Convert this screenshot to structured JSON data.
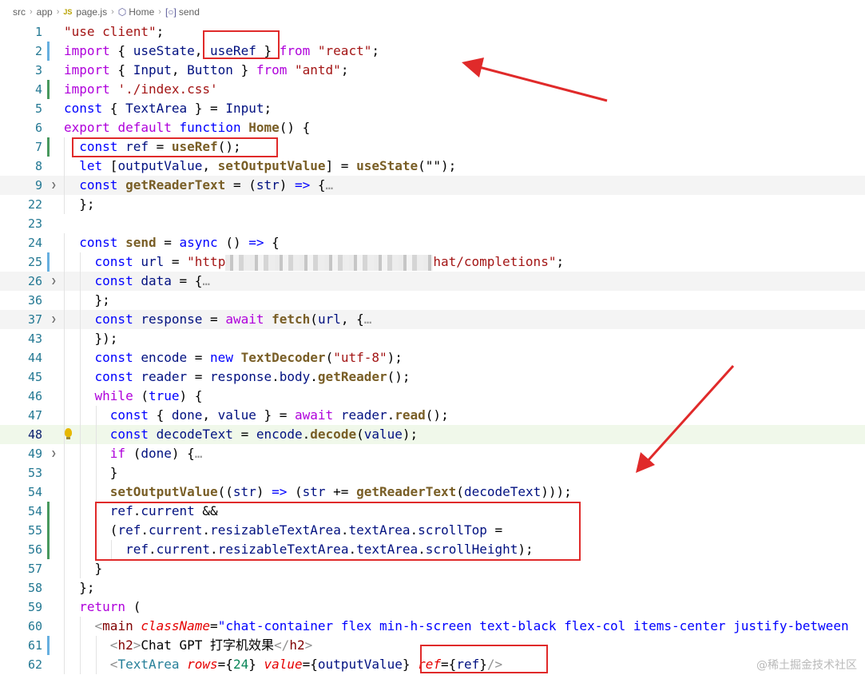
{
  "breadcrumb": {
    "items": [
      {
        "label": "src"
      },
      {
        "label": "app"
      },
      {
        "badge": "JS",
        "label": "page.js"
      },
      {
        "label": "Home"
      },
      {
        "label": "send"
      }
    ]
  },
  "editor": {
    "code_lines": [
      {
        "num": "1",
        "tokens": [
          [
            "str",
            "\"use client\""
          ],
          [
            "pun",
            ";"
          ]
        ]
      },
      {
        "num": "2",
        "tokens": [
          [
            "ctl",
            "import"
          ],
          [
            "pun",
            " { "
          ],
          [
            "",
            "useState"
          ],
          [
            "pun",
            ", "
          ],
          [
            "",
            "useRef"
          ],
          [
            "pun",
            " } "
          ],
          [
            "ctl",
            "from"
          ],
          [
            "pun",
            " "
          ],
          [
            "str",
            "\"react\""
          ],
          [
            "pun",
            ";"
          ]
        ]
      },
      {
        "num": "3",
        "tokens": [
          [
            "ctl",
            "import"
          ],
          [
            "pun",
            " { "
          ],
          [
            "",
            "Input"
          ],
          [
            "pun",
            ", "
          ],
          [
            "",
            "Button"
          ],
          [
            "pun",
            " } "
          ],
          [
            "ctl",
            "from"
          ],
          [
            "pun",
            " "
          ],
          [
            "str",
            "\"antd\""
          ],
          [
            "pun",
            ";"
          ]
        ]
      },
      {
        "num": "4",
        "tokens": [
          [
            "ctl",
            "import"
          ],
          [
            "pun",
            " "
          ],
          [
            "str",
            "'./index.css'"
          ]
        ]
      },
      {
        "num": "5",
        "tokens": [
          [
            "kw",
            "const"
          ],
          [
            "pun",
            " { "
          ],
          [
            "",
            "TextArea"
          ],
          [
            "pun",
            " } = "
          ],
          [
            "",
            "Input"
          ],
          [
            "pun",
            ";"
          ]
        ]
      },
      {
        "num": "6",
        "tokens": [
          [
            "ctl",
            "export"
          ],
          [
            "pun",
            " "
          ],
          [
            "ctl",
            "default"
          ],
          [
            "pun",
            " "
          ],
          [
            "kw",
            "function"
          ],
          [
            "pun",
            " "
          ],
          [
            "fn",
            "Home"
          ],
          [
            "pun",
            "() {"
          ]
        ]
      },
      {
        "num": "7",
        "tokens": [
          [
            "pun",
            "  "
          ],
          [
            "kw",
            "const"
          ],
          [
            "pun",
            " "
          ],
          [
            "",
            "ref"
          ],
          [
            "pun",
            " = "
          ],
          [
            "fn",
            "useRef"
          ],
          [
            "pun",
            "();"
          ]
        ]
      },
      {
        "num": "8",
        "tokens": [
          [
            "pun",
            "  "
          ],
          [
            "kw",
            "let"
          ],
          [
            "pun",
            " ["
          ],
          [
            "",
            "outputValue"
          ],
          [
            "pun",
            ", "
          ],
          [
            "fn",
            "setOutputValue"
          ],
          [
            "pun",
            "] = "
          ],
          [
            "fn",
            "useState"
          ],
          [
            "pun",
            "(\"\");"
          ]
        ]
      },
      {
        "num": "9",
        "tokens": [
          [
            "pun",
            "  "
          ],
          [
            "kw",
            "const"
          ],
          [
            "pun",
            " "
          ],
          [
            "fn",
            "getReaderText"
          ],
          [
            "pun",
            " = ("
          ],
          [
            "",
            "str"
          ],
          [
            "pun",
            ") "
          ],
          [
            "kw",
            "=>"
          ],
          [
            "pun",
            " {"
          ],
          [
            "dim",
            "…"
          ]
        ]
      },
      {
        "num": "22",
        "tokens": [
          [
            "pun",
            "  };"
          ]
        ]
      },
      {
        "num": "23",
        "tokens": []
      },
      {
        "num": "24",
        "tokens": [
          [
            "pun",
            "  "
          ],
          [
            "kw",
            "const"
          ],
          [
            "pun",
            " "
          ],
          [
            "fn",
            "send"
          ],
          [
            "pun",
            " = "
          ],
          [
            "kw",
            "async"
          ],
          [
            "pun",
            " () "
          ],
          [
            "kw",
            "=>"
          ],
          [
            "pun",
            " {"
          ]
        ]
      },
      {
        "num": "25",
        "tokens": [
          [
            "pun",
            "    "
          ],
          [
            "kw",
            "const"
          ],
          [
            "pun",
            " "
          ],
          [
            "",
            "url"
          ],
          [
            "pun",
            " = "
          ],
          [
            "str",
            "\"http"
          ],
          [
            "blur",
            ""
          ],
          [
            "str",
            "hat/completions"
          ],
          [
            "str",
            "\""
          ],
          [
            "pun",
            ";"
          ]
        ]
      },
      {
        "num": "26",
        "tokens": [
          [
            "pun",
            "    "
          ],
          [
            "kw",
            "const"
          ],
          [
            "pun",
            " "
          ],
          [
            "",
            "data"
          ],
          [
            "pun",
            " = {"
          ],
          [
            "dim",
            "…"
          ]
        ]
      },
      {
        "num": "36",
        "tokens": [
          [
            "pun",
            "    };"
          ]
        ]
      },
      {
        "num": "37",
        "tokens": [
          [
            "pun",
            "    "
          ],
          [
            "kw",
            "const"
          ],
          [
            "pun",
            " "
          ],
          [
            "",
            "response"
          ],
          [
            "pun",
            " = "
          ],
          [
            "ctl",
            "await"
          ],
          [
            "pun",
            " "
          ],
          [
            "fn",
            "fetch"
          ],
          [
            "pun",
            "("
          ],
          [
            "",
            "url"
          ],
          [
            "pun",
            ", {"
          ],
          [
            "dim",
            "…"
          ]
        ]
      },
      {
        "num": "43",
        "tokens": [
          [
            "pun",
            "    });"
          ]
        ]
      },
      {
        "num": "44",
        "tokens": [
          [
            "pun",
            "    "
          ],
          [
            "kw",
            "const"
          ],
          [
            "pun",
            " "
          ],
          [
            "",
            "encode"
          ],
          [
            "pun",
            " = "
          ],
          [
            "kw",
            "new"
          ],
          [
            "pun",
            " "
          ],
          [
            "fn",
            "TextDecoder"
          ],
          [
            "pun",
            "("
          ],
          [
            "str",
            "\"utf-8\""
          ],
          [
            "pun",
            ");"
          ]
        ]
      },
      {
        "num": "45",
        "tokens": [
          [
            "pun",
            "    "
          ],
          [
            "kw",
            "const"
          ],
          [
            "pun",
            " "
          ],
          [
            "",
            "reader"
          ],
          [
            "pun",
            " = "
          ],
          [
            "",
            "response"
          ],
          [
            "pun",
            "."
          ],
          [
            "",
            "body"
          ],
          [
            "pun",
            "."
          ],
          [
            "fn",
            "getReader"
          ],
          [
            "pun",
            "();"
          ]
        ]
      },
      {
        "num": "46",
        "tokens": [
          [
            "pun",
            "    "
          ],
          [
            "ctl",
            "while"
          ],
          [
            "pun",
            " ("
          ],
          [
            "kw",
            "true"
          ],
          [
            "pun",
            ") {"
          ]
        ]
      },
      {
        "num": "47",
        "tokens": [
          [
            "pun",
            "      "
          ],
          [
            "kw",
            "const"
          ],
          [
            "pun",
            " { "
          ],
          [
            "",
            "done"
          ],
          [
            "pun",
            ", "
          ],
          [
            "",
            "value"
          ],
          [
            "pun",
            " } = "
          ],
          [
            "ctl",
            "await"
          ],
          [
            "pun",
            " "
          ],
          [
            "",
            "reader"
          ],
          [
            "pun",
            "."
          ],
          [
            "fn",
            "read"
          ],
          [
            "pun",
            "();"
          ]
        ]
      },
      {
        "num": "48",
        "tokens": [
          [
            "pun",
            "      "
          ],
          [
            "kw",
            "const"
          ],
          [
            "pun",
            " "
          ],
          [
            "",
            "decodeText"
          ],
          [
            "pun",
            " = "
          ],
          [
            "",
            "encode"
          ],
          [
            "pun",
            "."
          ],
          [
            "fn",
            "decode"
          ],
          [
            "pun",
            "("
          ],
          [
            "",
            "value"
          ],
          [
            "pun",
            ");"
          ]
        ]
      },
      {
        "num": "49",
        "tokens": [
          [
            "pun",
            "      "
          ],
          [
            "ctl",
            "if"
          ],
          [
            "pun",
            " ("
          ],
          [
            "",
            "done"
          ],
          [
            "pun",
            ") {"
          ],
          [
            "dim",
            "…"
          ]
        ]
      },
      {
        "num": "53",
        "tokens": [
          [
            "pun",
            "      }"
          ]
        ]
      },
      {
        "num": "54",
        "tokens": [
          [
            "pun",
            "      "
          ],
          [
            "fn",
            "setOutputValue"
          ],
          [
            "pun",
            "(("
          ],
          [
            "",
            "str"
          ],
          [
            "pun",
            ") "
          ],
          [
            "kw",
            "=>"
          ],
          [
            "pun",
            " ("
          ],
          [
            "",
            "str"
          ],
          [
            "pun",
            " += "
          ],
          [
            "fn",
            "getReaderText"
          ],
          [
            "pun",
            "("
          ],
          [
            "",
            "decodeText"
          ],
          [
            "pun",
            ")));"
          ]
        ]
      },
      {
        "num": "54",
        "tokens": [
          [
            "pun",
            "      "
          ],
          [
            "",
            "ref"
          ],
          [
            "pun",
            "."
          ],
          [
            "",
            "current"
          ],
          [
            "pun",
            " &&"
          ]
        ]
      },
      {
        "num": "55",
        "tokens": [
          [
            "pun",
            "      ("
          ],
          [
            "",
            "ref"
          ],
          [
            "pun",
            "."
          ],
          [
            "",
            "current"
          ],
          [
            "pun",
            "."
          ],
          [
            "",
            "resizableTextArea"
          ],
          [
            "pun",
            "."
          ],
          [
            "",
            "textArea"
          ],
          [
            "pun",
            "."
          ],
          [
            "",
            "scrollTop"
          ],
          [
            "pun",
            " ="
          ]
        ]
      },
      {
        "num": "56",
        "tokens": [
          [
            "pun",
            "        "
          ],
          [
            "",
            "ref"
          ],
          [
            "pun",
            "."
          ],
          [
            "",
            "current"
          ],
          [
            "pun",
            "."
          ],
          [
            "",
            "resizableTextArea"
          ],
          [
            "pun",
            "."
          ],
          [
            "",
            "textArea"
          ],
          [
            "pun",
            "."
          ],
          [
            "",
            "scrollHeight"
          ],
          [
            "pun",
            ");"
          ]
        ]
      },
      {
        "num": "57",
        "tokens": [
          [
            "pun",
            "    }"
          ]
        ]
      },
      {
        "num": "58",
        "tokens": [
          [
            "pun",
            "  };"
          ]
        ]
      },
      {
        "num": "59",
        "tokens": [
          [
            "pun",
            "  "
          ],
          [
            "ctl",
            "return"
          ],
          [
            "pun",
            " ("
          ]
        ]
      },
      {
        "num": "60",
        "tokens": [
          [
            "pun",
            "    "
          ],
          [
            "dim",
            "<"
          ],
          [
            "tag",
            "main"
          ],
          [
            "pun",
            " "
          ],
          [
            "att",
            "className"
          ],
          [
            "pun",
            "="
          ],
          [
            "kw",
            "\"chat-container flex min-h-screen text-black flex-col items-center justify-between"
          ]
        ]
      },
      {
        "num": "61",
        "tokens": [
          [
            "pun",
            "      "
          ],
          [
            "dim",
            "<"
          ],
          [
            "tag",
            "h2"
          ],
          [
            "dim",
            ">"
          ],
          [
            "pun",
            "Chat GPT 打字机效果"
          ],
          [
            "dim",
            "</"
          ],
          [
            "tag",
            "h2"
          ],
          [
            "dim",
            ">"
          ]
        ]
      },
      {
        "num": "62",
        "tokens": [
          [
            "pun",
            "      "
          ],
          [
            "dim",
            "<"
          ],
          [
            "cls",
            "TextArea"
          ],
          [
            "pun",
            " "
          ],
          [
            "att",
            "rows"
          ],
          [
            "pun",
            "={"
          ],
          [
            "num",
            "24"
          ],
          [
            "pun",
            "} "
          ],
          [
            "att",
            "value"
          ],
          [
            "pun",
            "={"
          ],
          [
            "",
            "outputValue"
          ],
          [
            "pun",
            "} "
          ],
          [
            "att",
            "ref"
          ],
          [
            "pun",
            "={"
          ],
          [
            "",
            "ref"
          ],
          [
            "pun",
            "}"
          ],
          [
            "dim",
            "/>"
          ]
        ]
      }
    ]
  },
  "watermark": "@稀土掘金技术社区",
  "colors": {
    "annotation_red": "#e02a2a",
    "current_line_bg": "#f0f8ea",
    "folded_line_bg": "#f4f4f4"
  }
}
